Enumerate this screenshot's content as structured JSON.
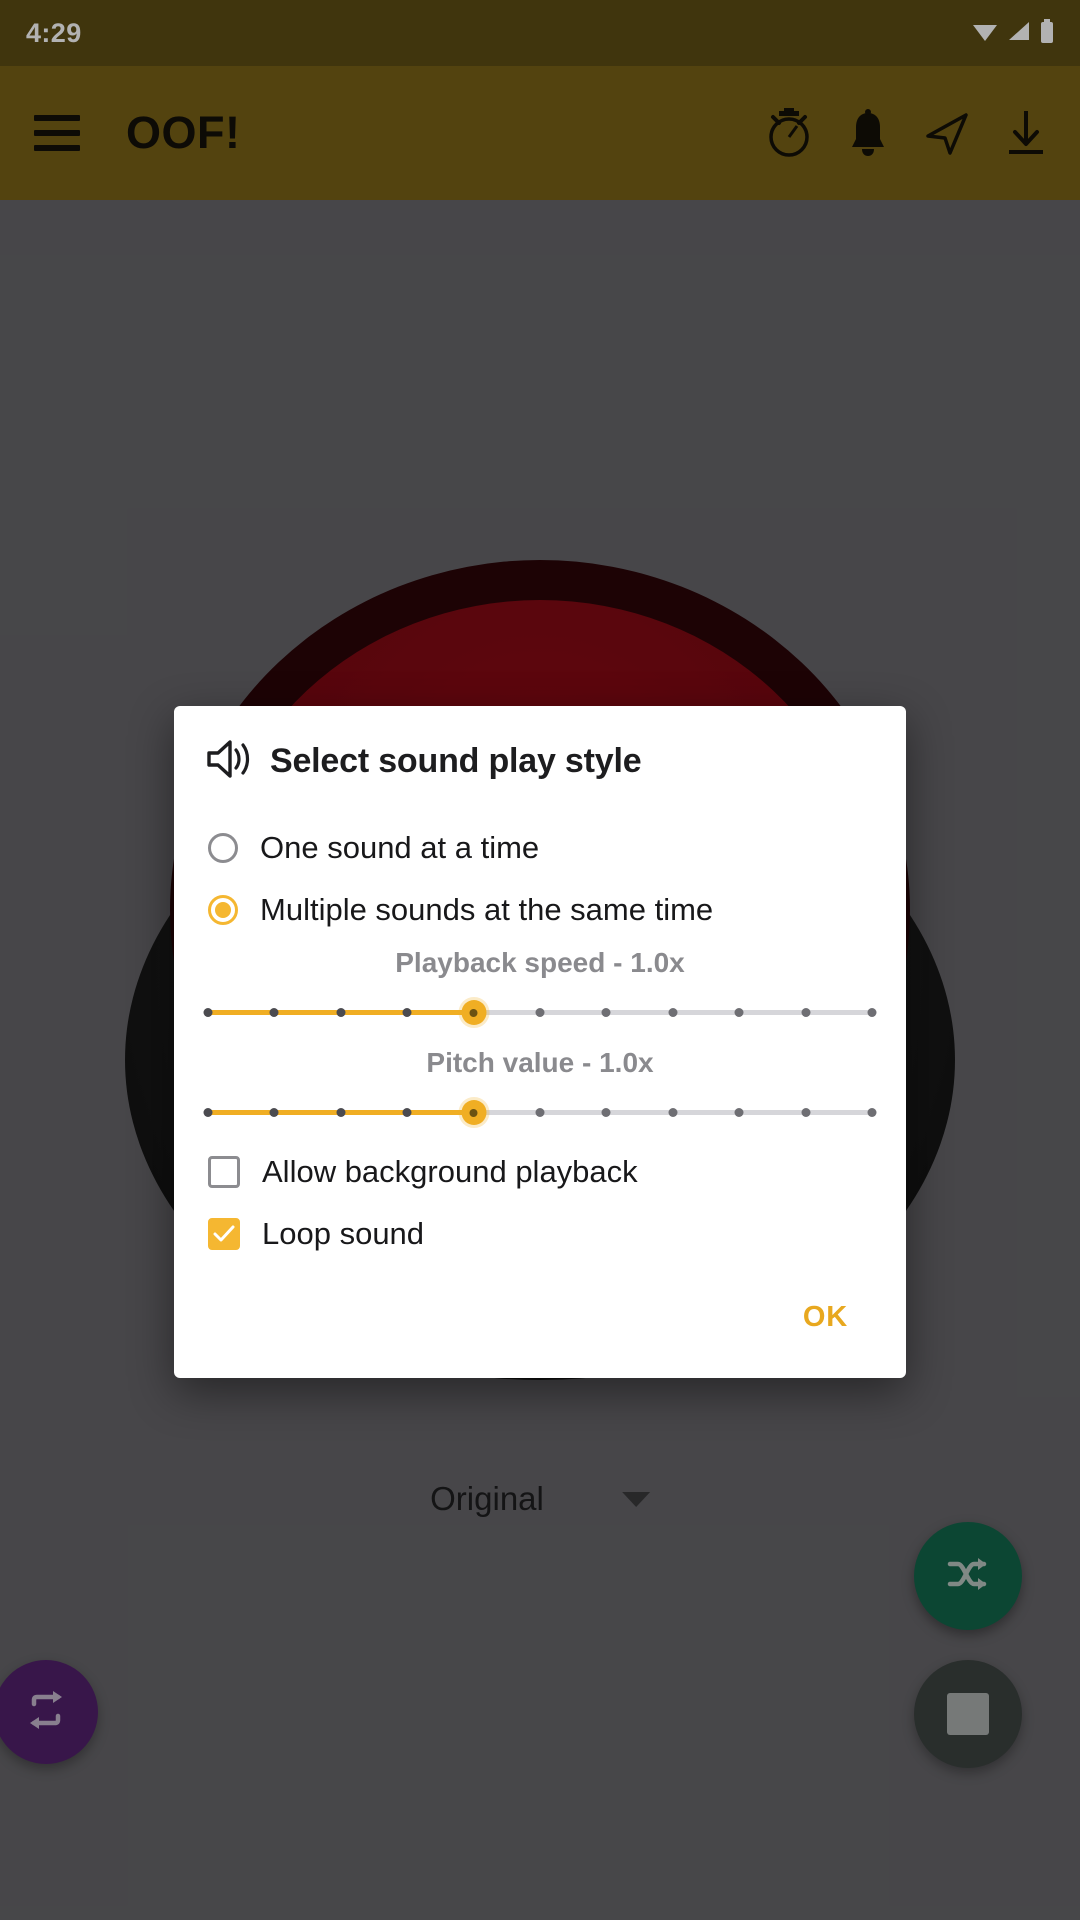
{
  "status_bar": {
    "time": "4:29",
    "icons": [
      "wifi-icon",
      "signal-icon",
      "battery-icon"
    ]
  },
  "app_bar": {
    "menu_icon": "hamburger-menu-icon",
    "title": "OOF!",
    "actions": [
      {
        "name": "timer-icon",
        "label": "Timer"
      },
      {
        "name": "bell-icon",
        "label": "Notifications"
      },
      {
        "name": "send-icon",
        "label": "Share"
      },
      {
        "name": "download-icon",
        "label": "Download"
      }
    ],
    "background_color": "#786016"
  },
  "main": {
    "sound_dropdown": {
      "value": "Original",
      "caret_icon": "chevron-down-icon"
    },
    "fabs": [
      {
        "name": "shuffle-fab",
        "icon": "shuffle-icon",
        "color": "#12654a"
      },
      {
        "name": "stop-fab",
        "icon": "stop-icon",
        "color": "#3c4240"
      },
      {
        "name": "repeat-fab",
        "icon": "repeat-icon",
        "color": "#51206b"
      }
    ]
  },
  "dialog": {
    "icon": "speaker-volume-icon",
    "title": "Select sound play style",
    "radio_options": [
      {
        "label": "One sound at a time",
        "selected": false
      },
      {
        "label": "Multiple sounds at the same time",
        "selected": true
      }
    ],
    "sliders": [
      {
        "name": "playback-speed-slider",
        "label": "Playback speed - 1.0x",
        "value": "1.0x",
        "ticks": 11,
        "active_index": 4
      },
      {
        "name": "pitch-value-slider",
        "label": "Pitch value - 1.0x",
        "value": "1.0x",
        "ticks": 11,
        "active_index": 4
      }
    ],
    "checkboxes": [
      {
        "label": "Allow background playback",
        "checked": false
      },
      {
        "label": "Loop sound",
        "checked": true
      }
    ],
    "ok_label": "OK",
    "accent_color": "#f5b731"
  }
}
